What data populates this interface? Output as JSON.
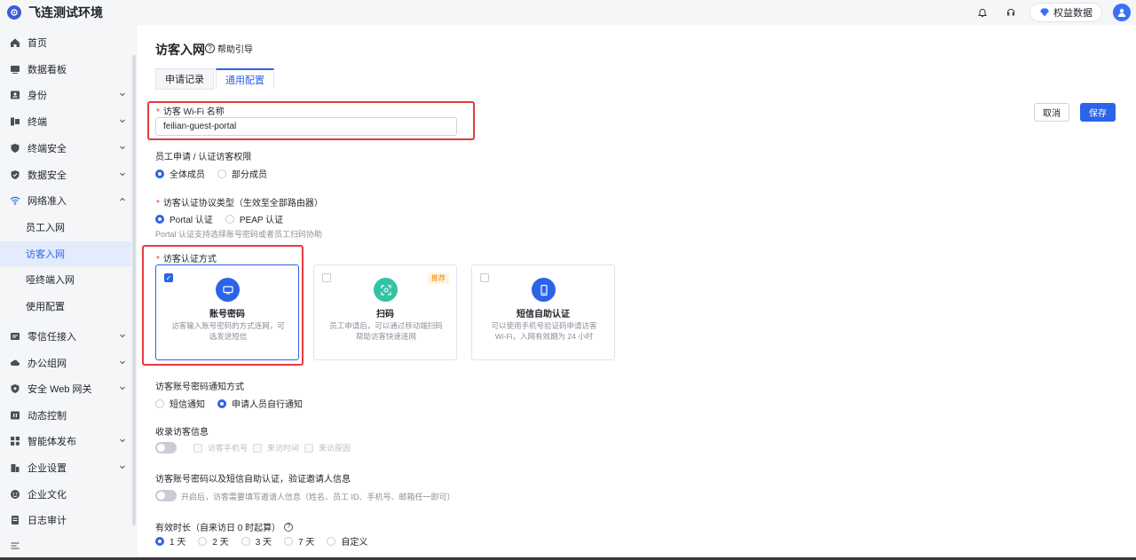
{
  "app": {
    "title": "飞连测试环境"
  },
  "topbar": {
    "rights_label": "权益数据"
  },
  "sidebar": {
    "items": [
      {
        "label": "首页"
      },
      {
        "label": "数据看板"
      },
      {
        "label": "身份"
      },
      {
        "label": "终端"
      },
      {
        "label": "终端安全"
      },
      {
        "label": "数据安全"
      },
      {
        "label": "网络准入"
      },
      {
        "label": "零信任接入"
      },
      {
        "label": "办公组网"
      },
      {
        "label": "安全 Web 网关"
      },
      {
        "label": "动态控制"
      },
      {
        "label": "智能体发布"
      },
      {
        "label": "企业设置"
      },
      {
        "label": "企业文化"
      },
      {
        "label": "日志审计"
      }
    ],
    "subitems": [
      {
        "label": "员工入网"
      },
      {
        "label": "访客入网"
      },
      {
        "label": "哑终端入网"
      },
      {
        "label": "使用配置"
      }
    ]
  },
  "page": {
    "title": "访客入网",
    "help": "帮助引导",
    "tabs": [
      {
        "label": "申请记录"
      },
      {
        "label": "通用配置"
      }
    ],
    "cancel": "取消",
    "save": "保存"
  },
  "form": {
    "wifi_label": "访客 Wi-Fi 名称",
    "wifi_value": "feilian-guest-portal",
    "perm_label": "员工申请 / 认证访客权限",
    "perm_opt1": "全体成员",
    "perm_opt2": "部分成员",
    "proto_label": "访客认证协议类型（生效至全部路由器）",
    "proto_opt1": "Portal 认证",
    "proto_opt2": "PEAP 认证",
    "proto_hint": "Portal 认证支持选择账号密码或者员工扫码协助",
    "method_label": "访客认证方式",
    "cards": [
      {
        "title": "账号密码",
        "desc": "访客输入账号密码的方式连网，可选发送短信"
      },
      {
        "title": "扫码",
        "desc": "员工申请后，可以通过移动端扫码帮助访客快速连网",
        "badge": "推荐"
      },
      {
        "title": "短信自助认证",
        "desc": "可以使用手机号验证码申请访客 Wi-Fi，入网有效期为 24 小时"
      }
    ],
    "notify_label": "访客账号密码通知方式",
    "notify_opt1": "短信通知",
    "notify_opt2": "申请人员自行通知",
    "collect_label": "收录访客信息",
    "collect_opts": [
      "访客手机号",
      "来访时间",
      "来访原因"
    ],
    "verify_label": "访客账号密码以及短信自助认证，验证邀请人信息",
    "verify_hint": "开启后，访客需要填写邀请人信息（姓名、员工 ID、手机号、邮箱任一即可）",
    "valid_label": "有效时长（自来访日 0 时起算）",
    "valid_opts": [
      "1 天",
      "2 天",
      "3 天",
      "7 天",
      "自定义"
    ]
  },
  "colors": {
    "accent": "#2b64e8",
    "highlight": "#e53b3b"
  }
}
